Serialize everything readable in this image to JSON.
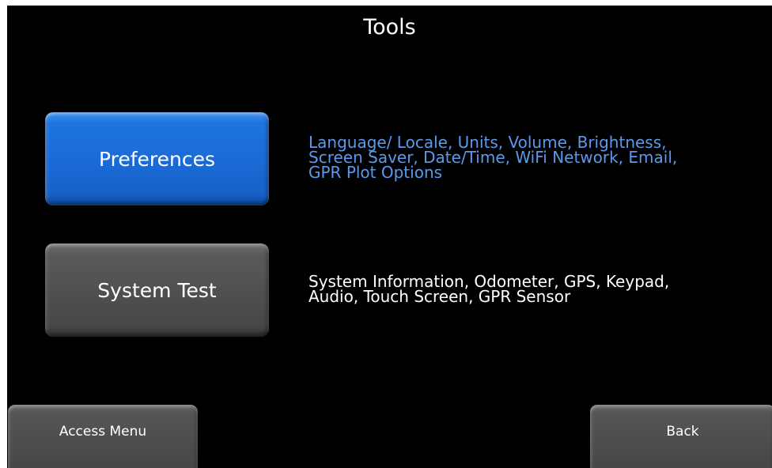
{
  "header": {
    "title": "Tools"
  },
  "tools": {
    "preferences": {
      "label": "Preferences",
      "description_lines": [
        "Language/ Locale, Units, Volume, Brightness,",
        "Screen Saver, Date/Time, WiFi Network, Email,",
        "GPR Plot Options"
      ]
    },
    "system_test": {
      "label": "System Test",
      "description_lines": [
        "System Information, Odometer, GPS, Keypad,",
        "Audio, Touch Screen, GPR Sensor"
      ]
    }
  },
  "footer": {
    "access_menu_label": "Access Menu",
    "back_label": "Back"
  },
  "colors": {
    "background": "#000000",
    "preferences_button": "#1a6ad6",
    "preferences_description": "#5b9aeb",
    "neutral_button": "#4f4f4f",
    "text": "#ffffff"
  }
}
